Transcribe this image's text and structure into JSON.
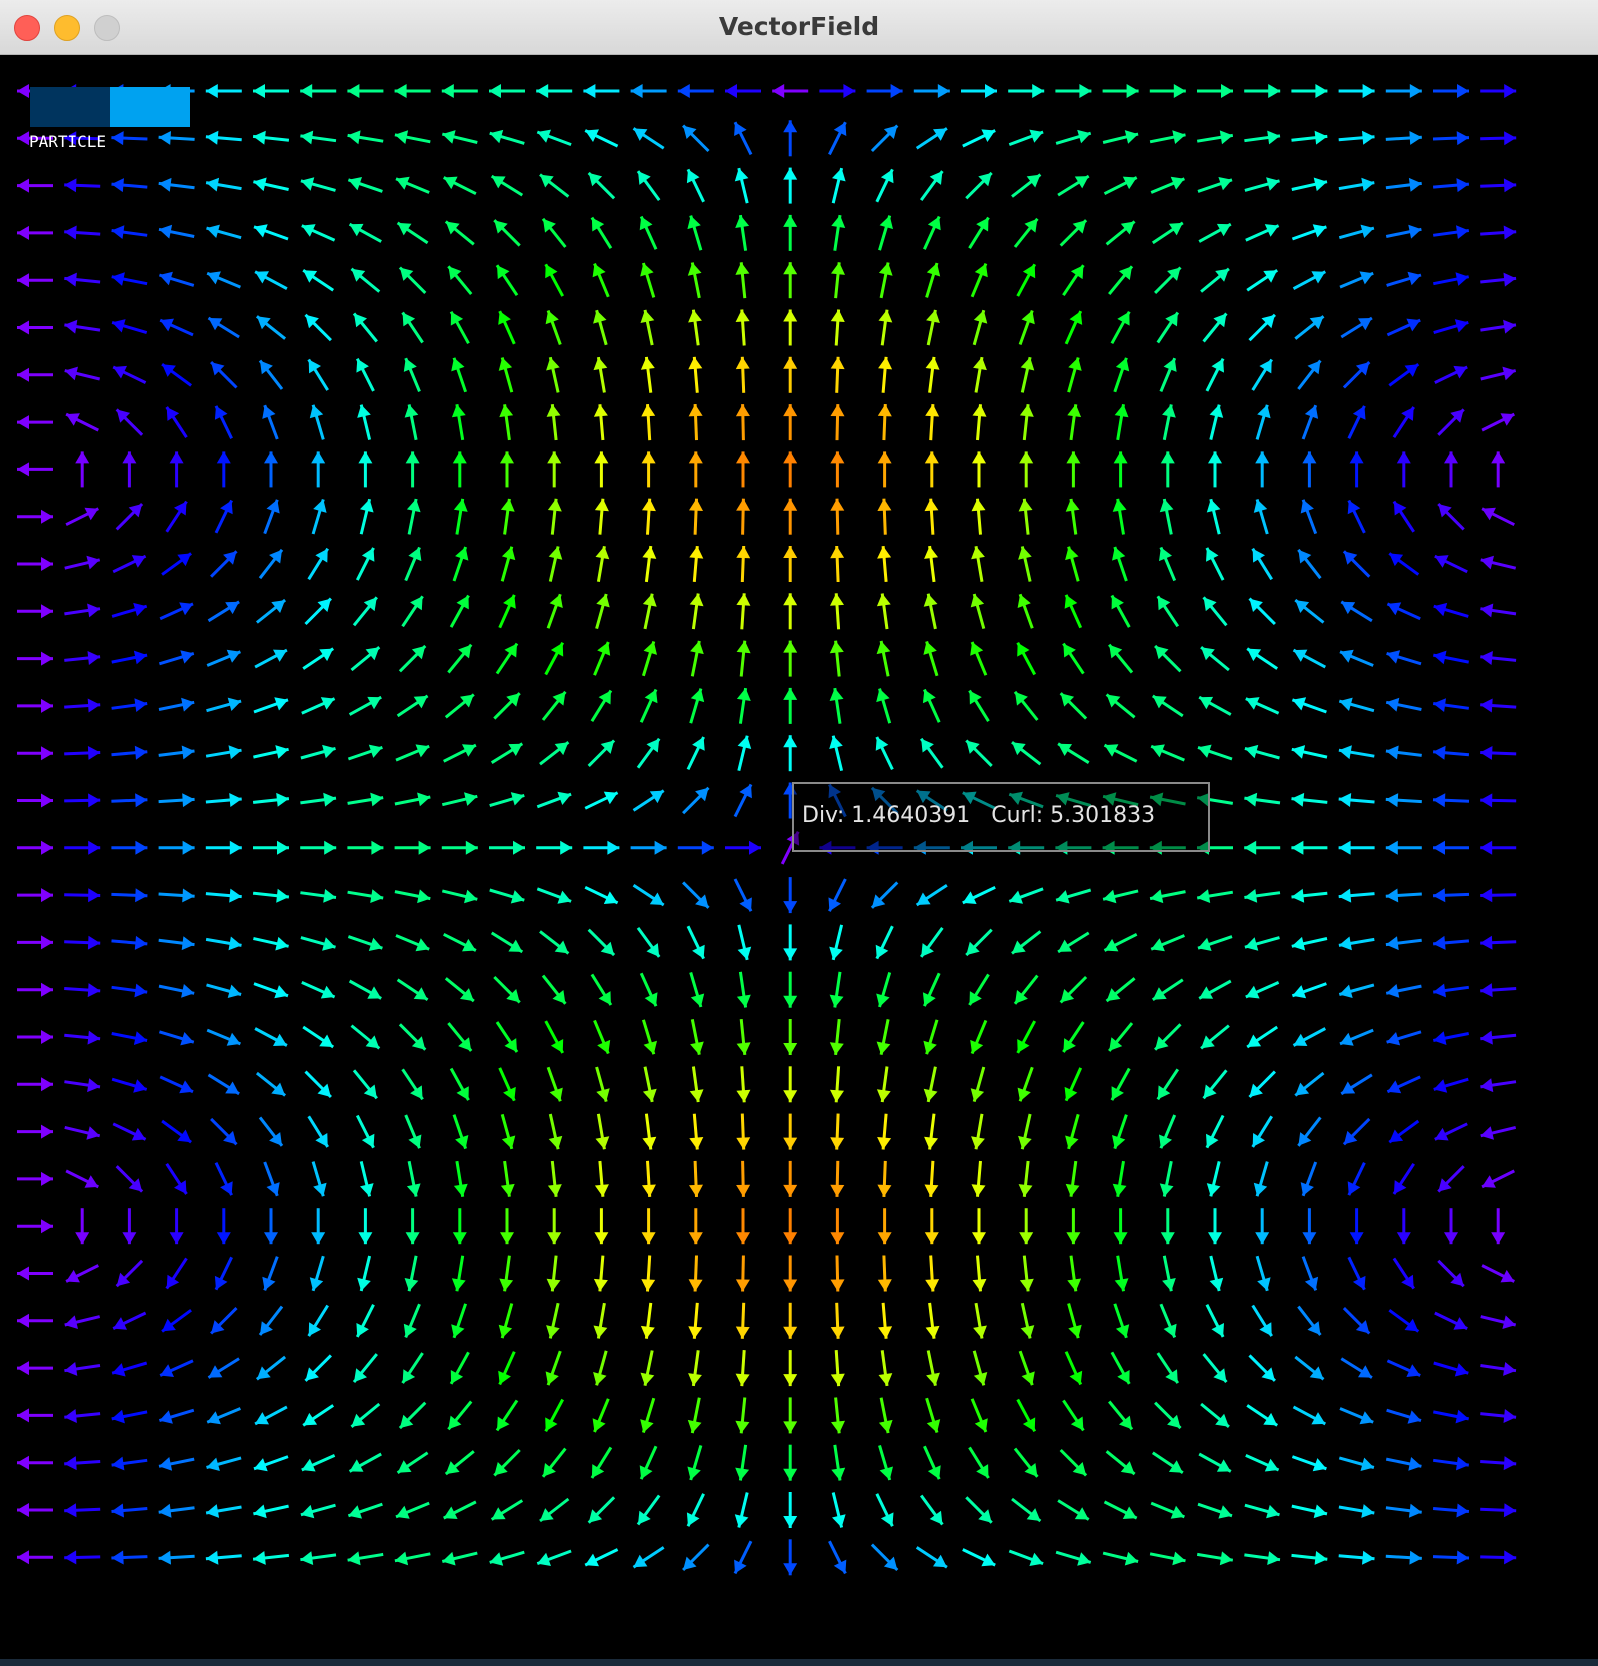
{
  "window": {
    "title": "VectorField",
    "controls": [
      "close",
      "minimize",
      "zoom"
    ]
  },
  "slider": {
    "label": "PARTICLE",
    "value": 0.5,
    "colors": {
      "filled": "#00345e",
      "track": "#00a2f0"
    }
  },
  "readout": {
    "div_label": "Div:",
    "div_value": "1.4640391",
    "curl_label": "Curl:",
    "curl_value": "5.301833"
  },
  "field": {
    "background": "#000000",
    "colormap": "hue-by-magnitude",
    "grid_columns": 32,
    "grid_rows": 32,
    "sinks": [
      "upper-left-center",
      "upper-right-center"
    ],
    "sources": [
      "lower-left-center",
      "lower-right-center"
    ],
    "vortices": [
      "left",
      "right"
    ]
  }
}
